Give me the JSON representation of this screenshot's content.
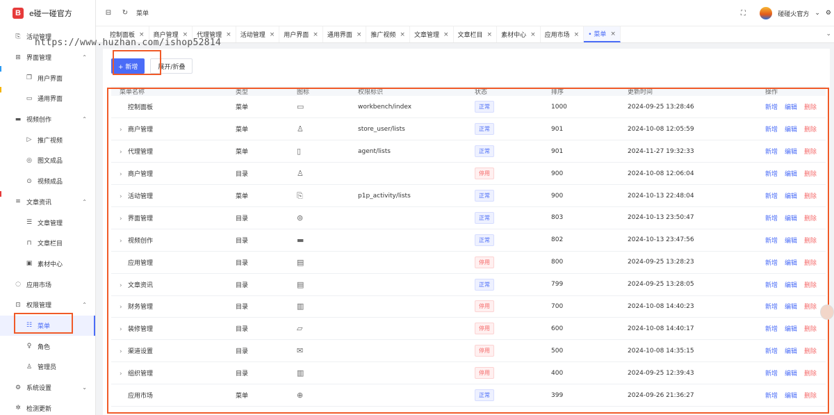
{
  "app": {
    "name": "e碰一碰官方"
  },
  "header": {
    "breadcrumb": "菜单",
    "user_name": "碰碰火官方"
  },
  "watermark": "https://www.huzhan.com/ishop52814",
  "sidebar": {
    "items": [
      {
        "label": "活动管理",
        "icon": "gift-icon",
        "level": 0
      },
      {
        "label": "界面管理",
        "icon": "layout-icon",
        "level": 0,
        "chevron": "^"
      },
      {
        "label": "用户界面",
        "icon": "copy-icon",
        "level": 1
      },
      {
        "label": "通用界面",
        "icon": "folder-icon",
        "level": 1
      },
      {
        "label": "视频创作",
        "icon": "camera-icon",
        "level": 0,
        "chevron": "^"
      },
      {
        "label": "推广视频",
        "icon": "video-icon",
        "level": 1
      },
      {
        "label": "图文成品",
        "icon": "image-icon",
        "level": 1
      },
      {
        "label": "视频成品",
        "icon": "play-icon",
        "level": 1
      },
      {
        "label": "文章资讯",
        "icon": "doc-icon",
        "level": 0,
        "chevron": "^"
      },
      {
        "label": "文章管理",
        "icon": "article-icon",
        "level": 1
      },
      {
        "label": "文章栏目",
        "icon": "bookmark-icon",
        "level": 1
      },
      {
        "label": "素材中心",
        "icon": "picture-icon",
        "level": 1
      },
      {
        "label": "应用市场",
        "icon": "market-icon",
        "level": 0
      },
      {
        "label": "权限管理",
        "icon": "lock-icon",
        "level": 0,
        "chevron": "^"
      },
      {
        "label": "菜单",
        "icon": "menu-icon",
        "level": 1,
        "active": true
      },
      {
        "label": "角色",
        "icon": "role-icon",
        "level": 1
      },
      {
        "label": "管理员",
        "icon": "admin-icon",
        "level": 1
      },
      {
        "label": "系统设置",
        "icon": "settings-icon",
        "level": 0,
        "chevron": "v"
      },
      {
        "label": "检测更新",
        "icon": "update-icon",
        "level": 0
      }
    ]
  },
  "tabs": [
    {
      "label": "控制面板"
    },
    {
      "label": "商户管理"
    },
    {
      "label": "代理管理"
    },
    {
      "label": "活动管理"
    },
    {
      "label": "用户界面"
    },
    {
      "label": "通用界面"
    },
    {
      "label": "推广视频"
    },
    {
      "label": "文章管理"
    },
    {
      "label": "文章栏目"
    },
    {
      "label": "素材中心"
    },
    {
      "label": "应用市场"
    },
    {
      "label": "• 菜单",
      "active": true
    }
  ],
  "toolbar": {
    "add_label": "+ 新增",
    "toggle_label": "展开/折叠"
  },
  "table": {
    "columns": [
      "菜单名称",
      "类型",
      "图标",
      "权限标识",
      "状态",
      "排序",
      "更新时间",
      "操作"
    ],
    "actions": {
      "add": "新增",
      "edit": "编辑",
      "delete": "删除"
    },
    "rows": [
      {
        "name": "控制面板",
        "expandable": false,
        "type": "菜单",
        "icon": "monitor-icon",
        "perm": "workbench/index",
        "status": "正常",
        "status_ok": true,
        "sort": "1000",
        "updated": "2024-09-25 13:28:46"
      },
      {
        "name": "商户管理",
        "expandable": true,
        "type": "菜单",
        "icon": "user-icon",
        "perm": "store_user/lists",
        "status": "正常",
        "status_ok": true,
        "sort": "901",
        "updated": "2024-10-08 12:05:59"
      },
      {
        "name": "代理管理",
        "expandable": true,
        "type": "菜单",
        "icon": "clipboard-icon",
        "perm": "agent/lists",
        "status": "正常",
        "status_ok": true,
        "sort": "901",
        "updated": "2024-11-27 19:32:33"
      },
      {
        "name": "商户管理",
        "expandable": true,
        "type": "目录",
        "icon": "user-icon",
        "perm": "",
        "status": "停用",
        "status_ok": false,
        "sort": "900",
        "updated": "2024-10-08 12:06:04"
      },
      {
        "name": "活动管理",
        "expandable": true,
        "type": "菜单",
        "icon": "gift-icon",
        "perm": "p1p_activity/lists",
        "status": "正常",
        "status_ok": true,
        "sort": "900",
        "updated": "2024-10-13 22:48:04"
      },
      {
        "name": "界面管理",
        "expandable": true,
        "type": "目录",
        "icon": "layers-icon",
        "perm": "",
        "status": "正常",
        "status_ok": true,
        "sort": "803",
        "updated": "2024-10-13 23:50:47"
      },
      {
        "name": "视频创作",
        "expandable": true,
        "type": "目录",
        "icon": "camera-icon",
        "perm": "",
        "status": "正常",
        "status_ok": true,
        "sort": "802",
        "updated": "2024-10-13 23:47:56"
      },
      {
        "name": "应用管理",
        "expandable": false,
        "type": "目录",
        "icon": "card-icon",
        "perm": "",
        "status": "停用",
        "status_ok": false,
        "sort": "800",
        "updated": "2024-09-25 13:28:23"
      },
      {
        "name": "文章资讯",
        "expandable": true,
        "type": "目录",
        "icon": "message-icon",
        "perm": "",
        "status": "正常",
        "status_ok": true,
        "sort": "799",
        "updated": "2024-09-25 13:28:05"
      },
      {
        "name": "财务管理",
        "expandable": true,
        "type": "目录",
        "icon": "chart-icon",
        "perm": "",
        "status": "停用",
        "status_ok": false,
        "sort": "700",
        "updated": "2024-10-08 14:40:23"
      },
      {
        "name": "装修管理",
        "expandable": true,
        "type": "目录",
        "icon": "brush-icon",
        "perm": "",
        "status": "停用",
        "status_ok": false,
        "sort": "600",
        "updated": "2024-10-08 14:40:17"
      },
      {
        "name": "渠道设置",
        "expandable": true,
        "type": "目录",
        "icon": "mail-icon",
        "perm": "",
        "status": "停用",
        "status_ok": false,
        "sort": "500",
        "updated": "2024-10-08 14:35:15"
      },
      {
        "name": "组织管理",
        "expandable": true,
        "type": "目录",
        "icon": "building-icon",
        "perm": "",
        "status": "停用",
        "status_ok": false,
        "sort": "400",
        "updated": "2024-09-25 12:39:43"
      },
      {
        "name": "应用市场",
        "expandable": false,
        "type": "菜单",
        "icon": "compass-icon",
        "perm": "",
        "status": "正常",
        "status_ok": true,
        "sort": "399",
        "updated": "2024-09-26 21:36:27"
      }
    ]
  },
  "colors": {
    "primary": "#4a6cf7",
    "danger": "#f56c6c",
    "highlight": "#f05a28",
    "logo": "#e63a3a"
  }
}
